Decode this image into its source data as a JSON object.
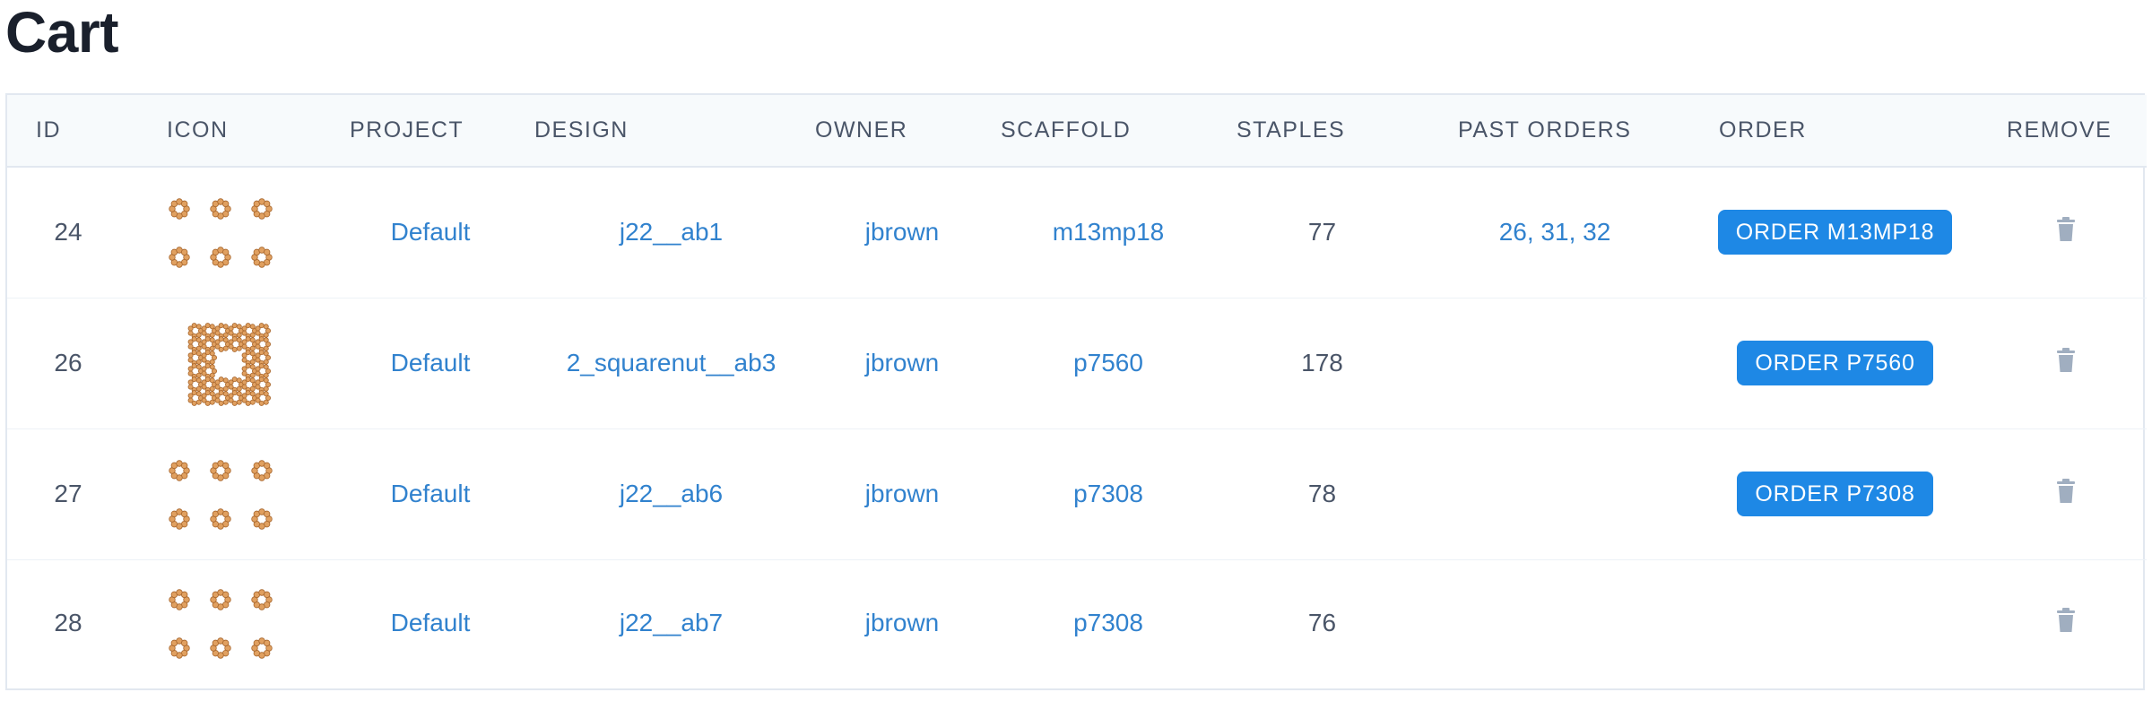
{
  "page": {
    "title": "Cart"
  },
  "colors": {
    "link": "#3182ce",
    "button": "#1e88e5",
    "icon_orange": "#e0a060",
    "trash": "#a0aec0"
  },
  "table": {
    "headers": [
      "ID",
      "ICON",
      "PROJECT",
      "DESIGN",
      "OWNER",
      "SCAFFOLD",
      "STAPLES",
      "PAST ORDERS",
      "ORDER",
      "REMOVE"
    ],
    "rows": [
      {
        "id": "24",
        "icon": "six-ring-design-icon",
        "project": "Default",
        "design": "j22__ab1",
        "owner": "jbrown",
        "scaffold": "m13mp18",
        "staples": "77",
        "past_orders": "26, 31, 32",
        "order_label": "ORDER M13MP18"
      },
      {
        "id": "26",
        "icon": "square-nut-design-icon",
        "project": "Default",
        "design": "2_squarenut__ab3",
        "owner": "jbrown",
        "scaffold": "p7560",
        "staples": "178",
        "past_orders": "",
        "order_label": "ORDER P7560"
      },
      {
        "id": "27",
        "icon": "six-ring-design-icon",
        "project": "Default",
        "design": "j22__ab6",
        "owner": "jbrown",
        "scaffold": "p7308",
        "staples": "78",
        "past_orders": "",
        "order_label": "ORDER P7308"
      },
      {
        "id": "28",
        "icon": "six-ring-design-icon",
        "project": "Default",
        "design": "j22__ab7",
        "owner": "jbrown",
        "scaffold": "p7308",
        "staples": "76",
        "past_orders": "",
        "order_label": ""
      }
    ]
  }
}
